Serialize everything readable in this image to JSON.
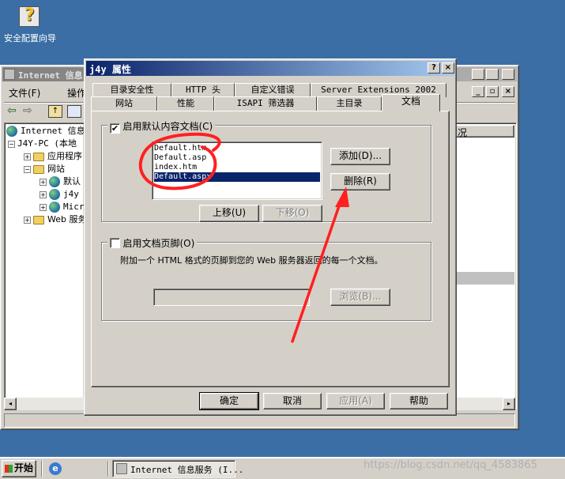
{
  "desktop": {
    "icon_label": "安全配置向导",
    "icon_glyph": "?"
  },
  "bg_window": {
    "title": "Internet 信息",
    "menu": [
      "文件(F)",
      "操作"
    ],
    "tree": [
      {
        "label": "Internet 信息..",
        "level": 0
      },
      {
        "label": "J4Y-PC (本地",
        "level": 1
      },
      {
        "label": "应用程序",
        "level": 2
      },
      {
        "label": "网站",
        "level": 2
      },
      {
        "label": "默认",
        "level": 3
      },
      {
        "label": "j4y",
        "level": 3
      },
      {
        "label": "Micr",
        "level": 3
      },
      {
        "label": "Web 服务",
        "level": 2
      }
    ],
    "right_header": "况"
  },
  "dialog": {
    "title": "j4y 属性",
    "help_btn": "?",
    "close_btn": "×",
    "tabs_back": [
      "目录安全性",
      "HTTP 头",
      "自定义错误",
      "Server Extensions 2002"
    ],
    "tabs_front": [
      "网站",
      "性能",
      "ISAPI 筛选器",
      "主目录",
      "文档"
    ],
    "enable_default_doc": {
      "label": "启用默认内容文档(C)",
      "checked": true
    },
    "default_docs": [
      "Default.htm",
      "Default.asp",
      "index.htm",
      "Default.aspx"
    ],
    "selected_index": 3,
    "add_btn": "添加(D)...",
    "remove_btn": "删除(R)",
    "move_up_btn": "上移(U)",
    "move_down_btn": "下移(O)",
    "enable_footer": {
      "label": "启用文档页脚(O)",
      "checked": false
    },
    "footer_desc": "附加一个 HTML 格式的页脚到您的 Web 服务器返回的每一个文档。",
    "browse_btn": "浏览(B)...",
    "ok_btn": "确定",
    "cancel_btn": "取消",
    "apply_btn": "应用(A)",
    "help_btn_label": "帮助"
  },
  "taskbar": {
    "start": "开始",
    "task_item": "Internet 信息服务 (I...",
    "watermark": "https://blog.csdn.net/qq_4583865"
  },
  "annotation_color": "#ff2020"
}
